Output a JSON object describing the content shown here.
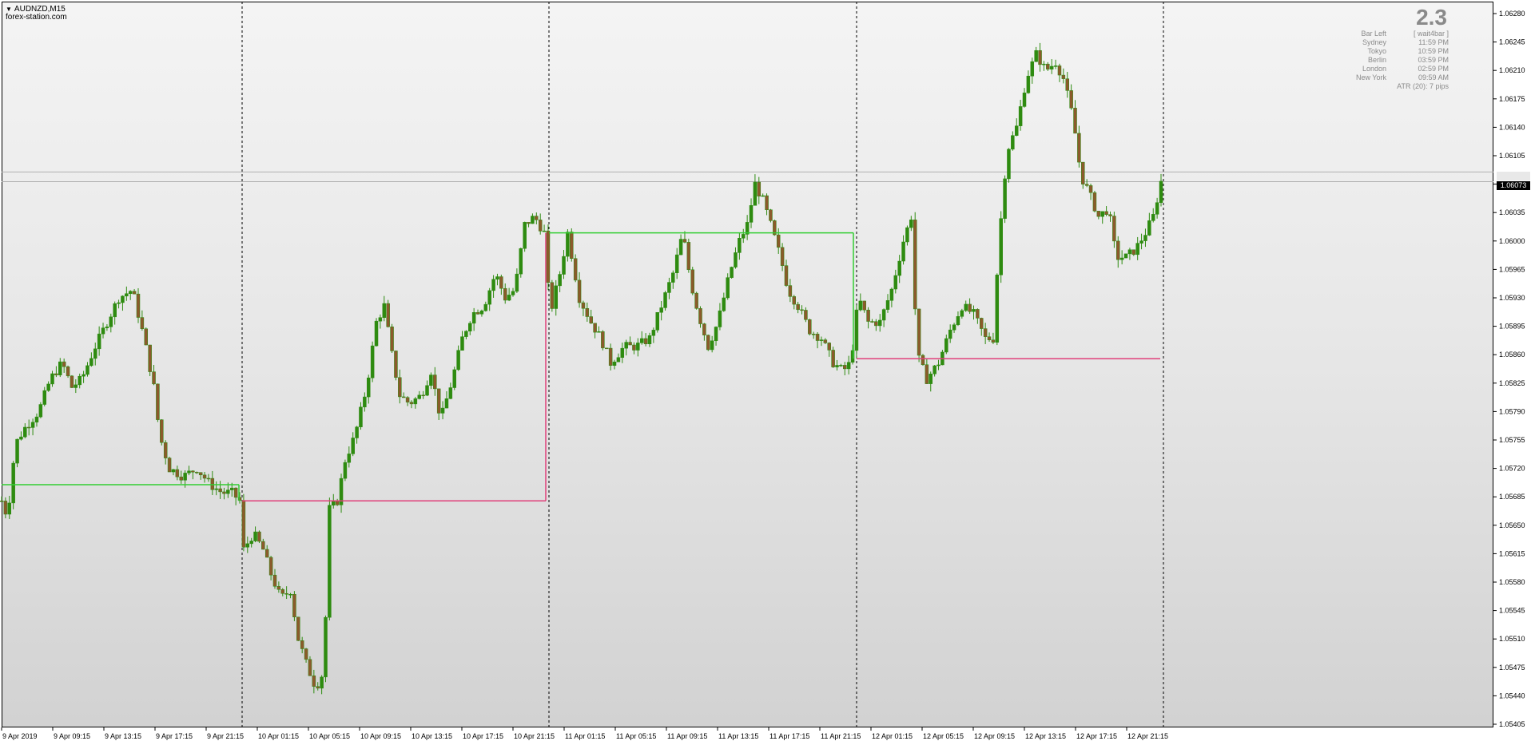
{
  "window": {
    "title": "AUDNZD,M15",
    "watermark": "forex-station.com"
  },
  "info_panel": {
    "big_value": "2.3",
    "rows": [
      {
        "key": "Bar Left",
        "value": "[ wait4bar ]"
      },
      {
        "key": "Sydney",
        "value": "11:59 PM"
      },
      {
        "key": "Tokyo",
        "value": "10:59 PM"
      },
      {
        "key": "Berlin",
        "value": "03:59 PM"
      },
      {
        "key": "London",
        "value": "02:59 PM"
      },
      {
        "key": "New York",
        "value": "09:59 AM"
      }
    ],
    "atr": "ATR (20): 7 pips"
  },
  "current_price": "1.06073",
  "colors": {
    "background_top": "#f4f4f4",
    "background_bottom": "#d2d2d2",
    "bull_candle": "#2e8b10",
    "bear_candle": "#8b5a2b",
    "wick": "#2e8b10",
    "session_high": "#32cd32",
    "session_low": "#e0407a",
    "axis_text": "#000000",
    "separator": "#000000"
  },
  "chart_data": {
    "type": "candlestick",
    "symbol": "AUDNZD",
    "timeframe": "M15",
    "y_axis_ticks": [
      "1.06280",
      "1.06245",
      "1.06210",
      "1.06175",
      "1.06140",
      "1.06105",
      "1.06070",
      "1.06035",
      "1.06000",
      "1.05965",
      "1.05930",
      "1.05895",
      "1.05860",
      "1.05825",
      "1.05790",
      "1.05755",
      "1.05720",
      "1.05685",
      "1.05650",
      "1.05615",
      "1.05580",
      "1.05545",
      "1.05510",
      "1.05475",
      "1.05440",
      "1.05405"
    ],
    "ylim": [
      1.05405,
      1.0628
    ],
    "x_axis_ticks": [
      "9 Apr 2019",
      "9 Apr 09:15",
      "9 Apr 13:15",
      "9 Apr 17:15",
      "9 Apr 21:15",
      "10 Apr 01:15",
      "10 Apr 05:15",
      "10 Apr 09:15",
      "10 Apr 13:15",
      "10 Apr 17:15",
      "10 Apr 21:15",
      "11 Apr 01:15",
      "11 Apr 05:15",
      "11 Apr 09:15",
      "11 Apr 13:15",
      "11 Apr 17:15",
      "11 Apr 21:15",
      "12 Apr 01:15",
      "12 Apr 05:15",
      "12 Apr 09:15",
      "12 Apr 13:15",
      "12 Apr 17:15",
      "12 Apr 21:15"
    ],
    "grid": false,
    "day_separators": [
      "9 Apr 23:00",
      "10 Apr 23:00",
      "11 Apr 23:00",
      "12 Apr 23:00"
    ],
    "session_lines": [
      {
        "kind": "high",
        "from": "9 Apr 2019",
        "to": "9 Apr 23:00",
        "value": 1.057
      },
      {
        "kind": "low",
        "from": "9 Apr 23:00",
        "to": "10 Apr 23:00",
        "value": 1.0568
      },
      {
        "kind": "high",
        "from": "10 Apr 23:00",
        "to": "11 Apr 23:00",
        "value": 1.0601
      },
      {
        "kind": "low",
        "from": "11 Apr 23:00",
        "to": "12 Apr 23:00",
        "value": 1.05855
      }
    ],
    "horizontal_lines": [
      1.06085,
      1.06073
    ],
    "price_path": [
      [
        0,
        1.0568
      ],
      [
        6,
        1.0566
      ],
      [
        14,
        1.0575
      ],
      [
        24,
        1.0577
      ],
      [
        38,
        1.0579
      ],
      [
        50,
        1.0583
      ],
      [
        62,
        1.0585
      ],
      [
        72,
        1.0582
      ],
      [
        82,
        1.0583
      ],
      [
        96,
        1.0587
      ],
      [
        108,
        1.059
      ],
      [
        120,
        1.0593
      ],
      [
        134,
        1.0594
      ],
      [
        146,
        1.0588
      ],
      [
        156,
        1.0582
      ],
      [
        162,
        1.0576
      ],
      [
        172,
        1.0572
      ],
      [
        186,
        1.0571
      ],
      [
        200,
        1.0572
      ],
      [
        214,
        1.057
      ],
      [
        226,
        1.0569
      ],
      [
        236,
        1.0569
      ],
      [
        244,
        1.0568
      ],
      [
        248,
        1.0562
      ],
      [
        258,
        1.0564
      ],
      [
        268,
        1.0562
      ],
      [
        276,
        1.0559
      ],
      [
        286,
        1.0556
      ],
      [
        296,
        1.0557
      ],
      [
        304,
        1.0551
      ],
      [
        312,
        1.0548
      ],
      [
        322,
        1.0545
      ],
      [
        330,
        1.0547
      ],
      [
        336,
        1.0567
      ],
      [
        344,
        1.0568
      ],
      [
        352,
        1.0573
      ],
      [
        362,
        1.0576
      ],
      [
        374,
        1.0582
      ],
      [
        384,
        1.059
      ],
      [
        392,
        1.0592
      ],
      [
        400,
        1.0586
      ],
      [
        408,
        1.0581
      ],
      [
        418,
        1.058
      ],
      [
        430,
        1.0581
      ],
      [
        440,
        1.0584
      ],
      [
        450,
        1.0578
      ],
      [
        462,
        1.0583
      ],
      [
        472,
        1.0588
      ],
      [
        482,
        1.0591
      ],
      [
        494,
        1.0592
      ],
      [
        506,
        1.0596
      ],
      [
        516,
        1.0593
      ],
      [
        526,
        1.0594
      ],
      [
        536,
        1.0602
      ],
      [
        546,
        1.0603
      ],
      [
        556,
        1.0601
      ],
      [
        562,
        1.0591
      ],
      [
        572,
        1.0596
      ],
      [
        580,
        1.0601
      ],
      [
        592,
        1.0593
      ],
      [
        604,
        1.059
      ],
      [
        614,
        1.0588
      ],
      [
        624,
        1.0585
      ],
      [
        638,
        1.0587
      ],
      [
        650,
        1.0587
      ],
      [
        664,
        1.0588
      ],
      [
        676,
        1.0592
      ],
      [
        688,
        1.0596
      ],
      [
        698,
        1.0601
      ],
      [
        706,
        1.0595
      ],
      [
        714,
        1.0591
      ],
      [
        724,
        1.0587
      ],
      [
        734,
        1.059
      ],
      [
        746,
        1.0596
      ],
      [
        756,
        1.06
      ],
      [
        764,
        1.0602
      ],
      [
        772,
        1.0607
      ],
      [
        780,
        1.0605
      ],
      [
        788,
        1.0602
      ],
      [
        798,
        1.0598
      ],
      [
        806,
        1.0594
      ],
      [
        816,
        1.0592
      ],
      [
        828,
        1.0589
      ],
      [
        840,
        1.0588
      ],
      [
        852,
        1.0585
      ],
      [
        862,
        1.0584
      ],
      [
        870,
        1.0585
      ],
      [
        878,
        1.0593
      ],
      [
        888,
        1.059
      ],
      [
        900,
        1.059
      ],
      [
        912,
        1.0594
      ],
      [
        924,
        1.06
      ],
      [
        932,
        1.0603
      ],
      [
        938,
        1.0586
      ],
      [
        948,
        1.0583
      ],
      [
        960,
        1.0585
      ],
      [
        972,
        1.0589
      ],
      [
        984,
        1.0592
      ],
      [
        996,
        1.0591
      ],
      [
        1008,
        1.0588
      ],
      [
        1016,
        1.0588
      ],
      [
        1022,
        1.06
      ],
      [
        1030,
        1.0611
      ],
      [
        1040,
        1.0614
      ],
      [
        1050,
        1.062
      ],
      [
        1060,
        1.0623
      ],
      [
        1070,
        1.0621
      ],
      [
        1080,
        1.0622
      ],
      [
        1088,
        1.062
      ],
      [
        1098,
        1.0615
      ],
      [
        1106,
        1.0608
      ],
      [
        1114,
        1.0606
      ],
      [
        1124,
        1.0603
      ],
      [
        1134,
        1.0604
      ],
      [
        1142,
        1.0598
      ],
      [
        1152,
        1.0598
      ],
      [
        1162,
        1.0599
      ],
      [
        1172,
        1.0601
      ],
      [
        1180,
        1.0603
      ],
      [
        1188,
        1.06073
      ]
    ]
  }
}
